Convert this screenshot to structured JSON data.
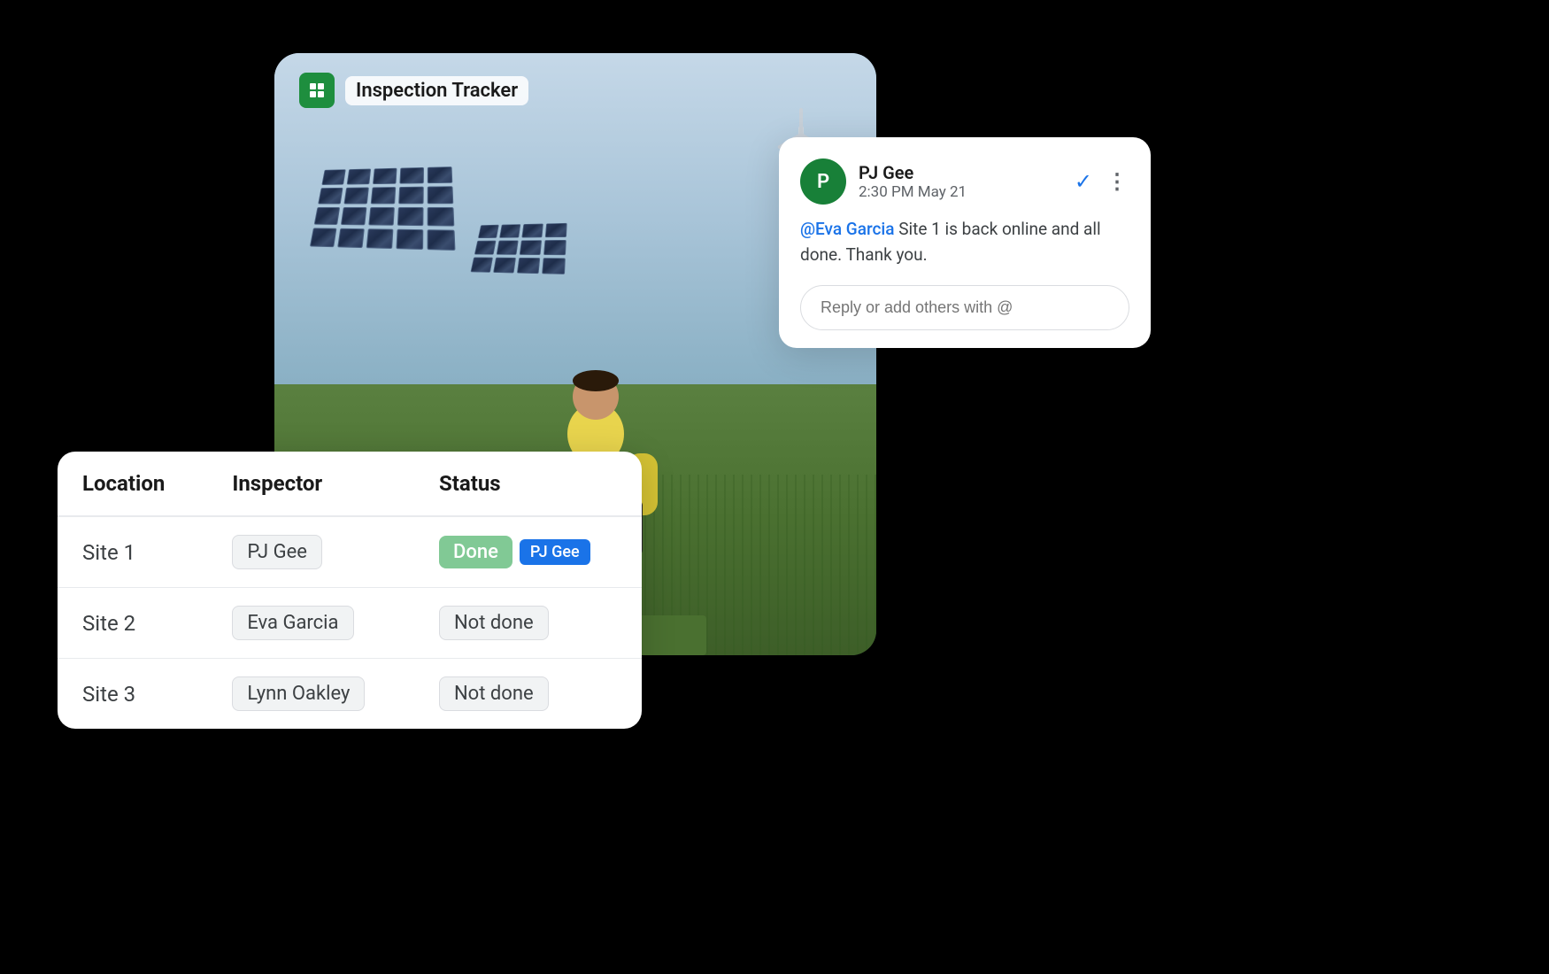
{
  "app": {
    "title": "Inspection Tracker"
  },
  "table": {
    "headers": [
      "Location",
      "Inspector",
      "Status"
    ],
    "rows": [
      {
        "location": "Site 1",
        "inspector": "PJ Gee",
        "status": "Done",
        "status_type": "done",
        "tag": "PJ Gee",
        "show_tag": true
      },
      {
        "location": "Site 2",
        "inspector": "Eva Garcia",
        "status": "Not done",
        "status_type": "not-done",
        "show_tag": false
      },
      {
        "location": "Site 3",
        "inspector": "Lynn Oakley",
        "status": "Not done",
        "status_type": "not-done",
        "show_tag": false
      }
    ]
  },
  "comment": {
    "avatar_initials": "P",
    "commenter_name": "PJ Gee",
    "comment_time": "2:30 PM May 21",
    "mention": "@Eva Garcia",
    "message": " Site 1 is back online and all done. Thank you.",
    "reply_placeholder": "Reply or add others with @",
    "check_icon": "✓",
    "more_icon": "⋮"
  }
}
